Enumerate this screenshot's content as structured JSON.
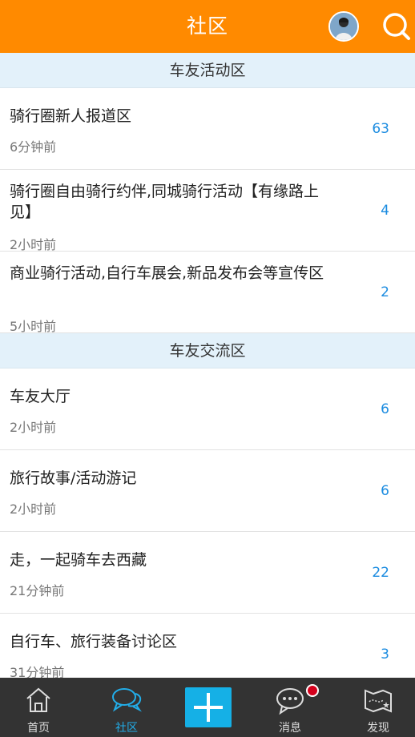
{
  "header": {
    "title": "社区"
  },
  "sections": [
    {
      "title": "车友活动区",
      "rows": [
        {
          "title": "骑行圈新人报道区",
          "time": "6分钟前",
          "count": "63"
        },
        {
          "title": "骑行圈自由骑行约伴,同城骑行活动【有缘路上见】",
          "time": "2小时前",
          "count": "4"
        },
        {
          "title": "商业骑行活动,自行车展会,新品发布会等宣传区",
          "time": "5小时前",
          "count": "2"
        }
      ]
    },
    {
      "title": "车友交流区",
      "rows": [
        {
          "title": "车友大厅",
          "time": "2小时前",
          "count": "6"
        },
        {
          "title": "旅行故事/活动游记",
          "time": "2小时前",
          "count": "6"
        },
        {
          "title": "走，一起骑车去西藏",
          "time": "21分钟前",
          "count": "22"
        },
        {
          "title": "自行车、旅行装备讨论区",
          "time": "31分钟前",
          "count": "3"
        }
      ]
    }
  ],
  "tabbar": {
    "home": "首页",
    "community": "社区",
    "messages": "消息",
    "discover": "发现"
  },
  "colors": {
    "header_bg": "#ff8a00",
    "section_bg": "#e3f1fa",
    "count_text": "#1a8be0",
    "tabbar_bg": "#333333",
    "tab_active": "#22aeea",
    "add_button": "#15b0e6",
    "badge": "#d4001c"
  },
  "icons": [
    "avatar",
    "search-icon",
    "home-icon",
    "chat-bubbles-icon",
    "plus-icon",
    "message-icon",
    "map-icon"
  ]
}
